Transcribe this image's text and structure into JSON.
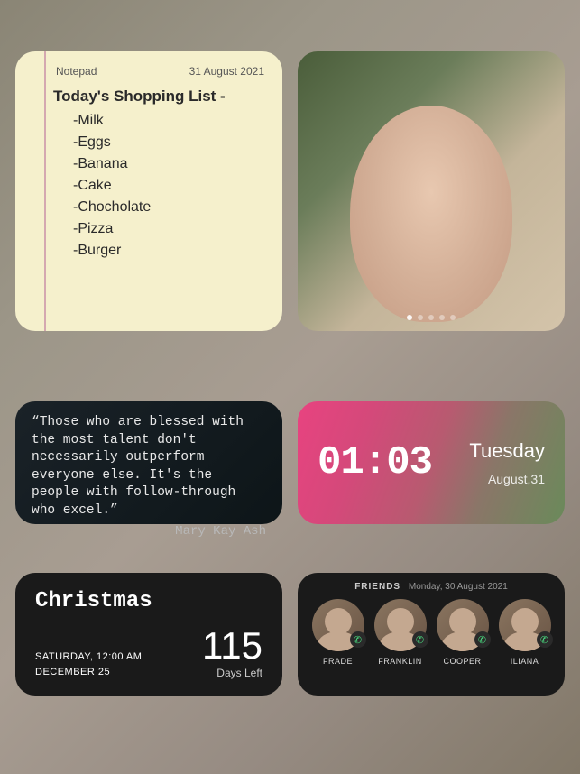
{
  "notepad": {
    "label": "Notepad",
    "date": "31 August 2021",
    "title": "Today's Shopping List -",
    "items": [
      "-Milk",
      "-Eggs",
      "-Banana",
      "-Cake",
      "-Chocholate",
      "-Pizza",
      "-Burger"
    ]
  },
  "photo": {
    "page_count": 5,
    "active_page": 1
  },
  "quote": {
    "text": "“Those who are blessed with the most talent don't necessarily outperform everyone else. It's the people with follow-through who excel.”",
    "author": "Mary Kay Ash"
  },
  "clock": {
    "time": "01:03",
    "day": "Tuesday",
    "month": "August,31"
  },
  "countdown": {
    "title": "Christmas",
    "weekday_time": "SATURDAY, 12:00 AM",
    "date": "DECEMBER 25",
    "number": "115",
    "label": "Days Left"
  },
  "friends": {
    "header_label": "FRIENDS",
    "header_date": "Monday, 30 August 2021",
    "list": [
      {
        "name": "FRADE"
      },
      {
        "name": "FRANKLIN"
      },
      {
        "name": "COOPER"
      },
      {
        "name": "ILIANA"
      }
    ]
  }
}
